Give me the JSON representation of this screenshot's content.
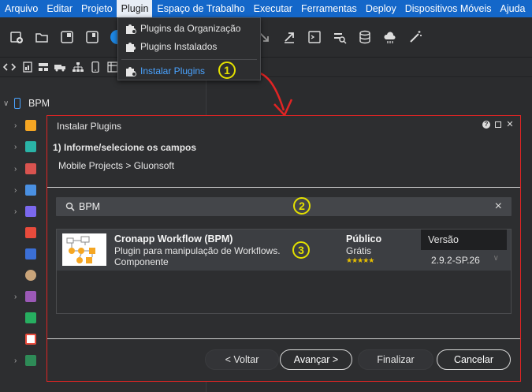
{
  "menubar": {
    "items": [
      "Arquivo",
      "Editar",
      "Projeto",
      "Plugin",
      "Espaço de Trabalho",
      "Executar",
      "Ferramentas",
      "Deploy",
      "Dispositivos Móveis",
      "Ajuda"
    ],
    "active": "Plugin",
    "bg_color": "#1467c9"
  },
  "plugin_menu": {
    "items": [
      "Plugins da Organização",
      "Plugins Instalados",
      "Instalar Plugins"
    ],
    "badge": "1"
  },
  "tree": {
    "root_label": "BPM"
  },
  "dialog": {
    "title": "Instalar Plugins",
    "step_title": "1) Informe/selecione os campos",
    "breadcrumb": "Mobile Projects > Gluonsoft",
    "border_color": "#e02424",
    "search": {
      "value": "BPM",
      "badge": "2"
    },
    "plugin": {
      "name": "Cronapp Workflow (BPM)",
      "description": "Plugin para manipulação de Workflows.",
      "type": "Componente",
      "access": "Público",
      "price": "Grátis",
      "rating": 5,
      "version_header": "Versão",
      "version": "2.9.2-SP.26",
      "badge": "3"
    },
    "buttons": {
      "back": "< Voltar",
      "next": "Avançar >",
      "finish": "Finalizar",
      "cancel": "Cancelar"
    }
  }
}
